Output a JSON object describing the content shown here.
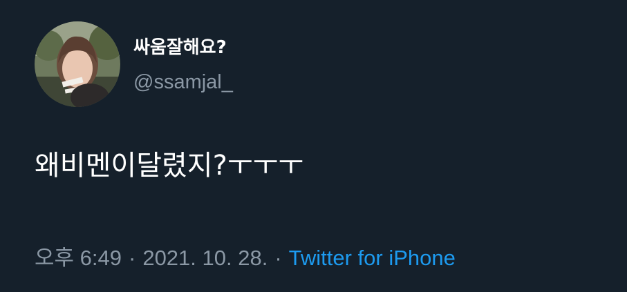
{
  "author": {
    "display_name": "싸움잘해요?",
    "handle": "@ssamjal_",
    "avatar_icon": "profile-photo"
  },
  "tweet": {
    "text": "왜비멘이달렸지?ㅜㅜㅜ"
  },
  "meta": {
    "time": "오후 6:49",
    "separator": "·",
    "date": "2021. 10. 28.",
    "source": "Twitter for iPhone"
  },
  "colors": {
    "background": "#15202b",
    "primary_text": "#ffffff",
    "secondary_text": "#8b98a5",
    "link": "#1d9bf0"
  }
}
